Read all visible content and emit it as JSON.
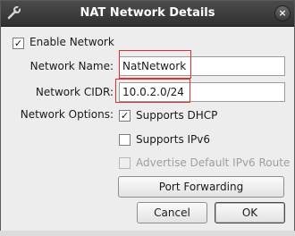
{
  "window": {
    "title": "NAT Network Details",
    "close_glyph": "×"
  },
  "enable_network": {
    "label": "Enable Network",
    "checked": true,
    "check_glyph": "✓"
  },
  "network_name": {
    "label": "Network Name:",
    "value": "NatNetwork"
  },
  "network_cidr": {
    "label": "Network CIDR:",
    "value": "10.0.2.0/24"
  },
  "network_options": {
    "label": "Network Options:",
    "supports_dhcp": {
      "label": "Supports DHCP",
      "checked": true,
      "check_glyph": "✓"
    },
    "supports_ipv6": {
      "label": "Supports IPv6",
      "checked": false
    },
    "advertise_ipv6_route": {
      "label": "Advertise Default IPv6 Route",
      "checked": false,
      "enabled": false
    }
  },
  "buttons": {
    "port_forwarding": "Port Forwarding",
    "cancel": "Cancel",
    "ok": "OK"
  },
  "colors": {
    "titlebar": "#3c3c3c",
    "highlight": "#e03030",
    "dialog_background": "#ededed"
  }
}
